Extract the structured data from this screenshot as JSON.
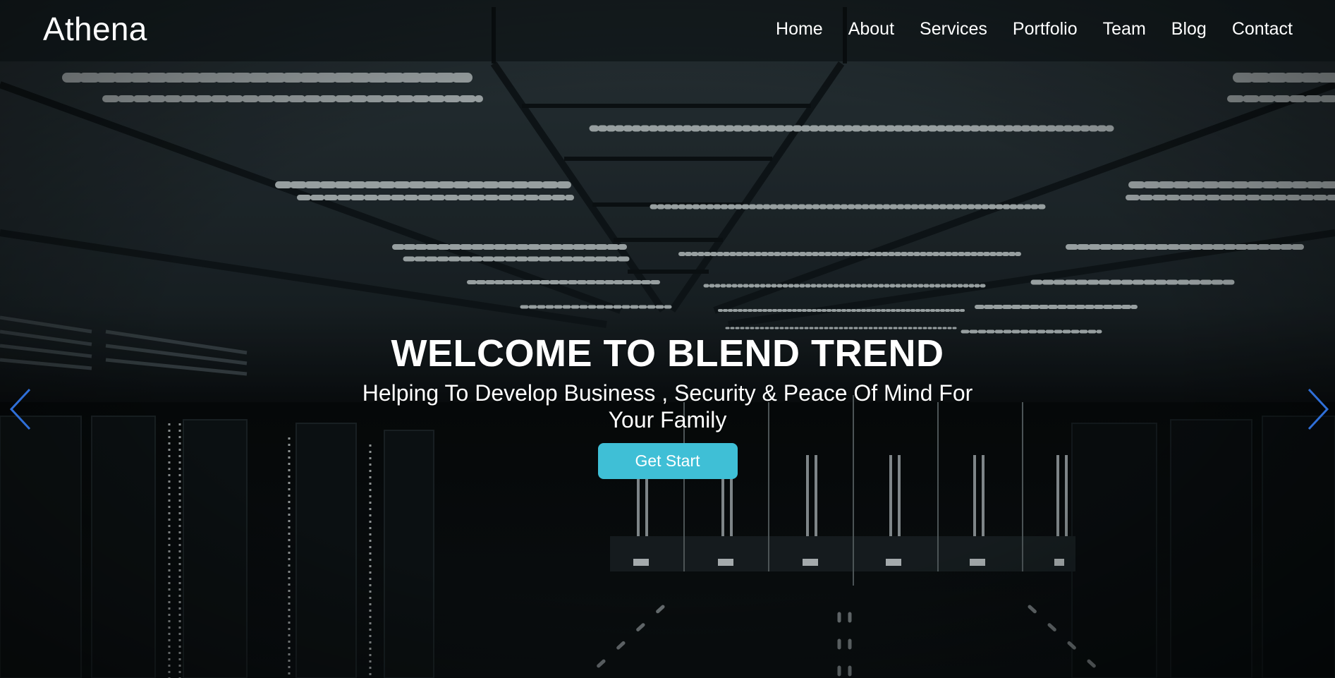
{
  "header": {
    "brand": "Athena",
    "nav": [
      {
        "label": "Home"
      },
      {
        "label": "About"
      },
      {
        "label": "Services"
      },
      {
        "label": "Portfolio"
      },
      {
        "label": "Team"
      },
      {
        "label": "Blog"
      },
      {
        "label": "Contact"
      }
    ]
  },
  "hero": {
    "title": "WELCOME TO BLEND TREND",
    "subtitle": "Helping To Develop Business , Security & Peace Of Mind For Your Family",
    "cta_label": "Get Start",
    "background": "dark-server-room-photo"
  },
  "carousel": {
    "prev_icon": "chevron-left-icon",
    "next_icon": "chevron-right-icon"
  },
  "colors": {
    "cta": "#3fbfd6",
    "arrow": "#2f6fd8",
    "header_bg": "#0c1113"
  }
}
